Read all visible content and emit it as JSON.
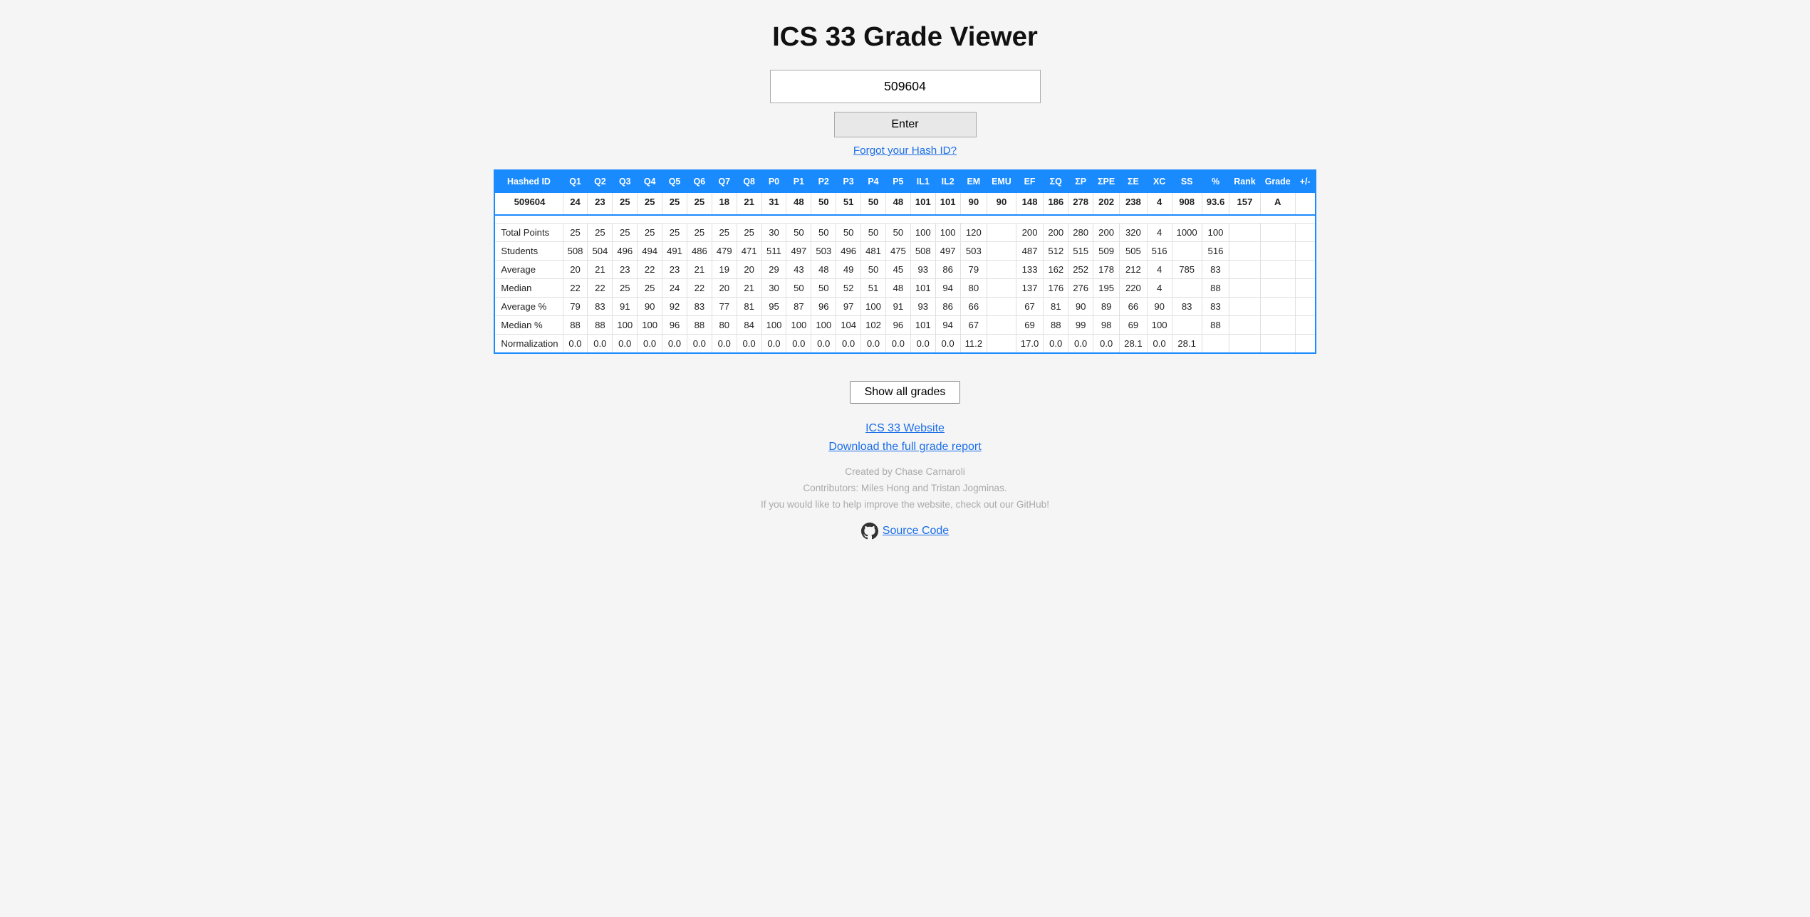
{
  "page": {
    "title": "ICS 33 Grade Viewer",
    "id_input_value": "509604",
    "id_input_placeholder": "",
    "enter_button_label": "Enter",
    "forgot_link_label": "Forgot your Hash ID?"
  },
  "table": {
    "headers": [
      "Hashed ID",
      "Q1",
      "Q2",
      "Q3",
      "Q4",
      "Q5",
      "Q6",
      "Q7",
      "Q8",
      "P0",
      "P1",
      "P2",
      "P3",
      "P4",
      "P5",
      "IL1",
      "IL2",
      "EM",
      "EMU",
      "EF",
      "ΣQ",
      "ΣP",
      "ΣPE",
      "ΣE",
      "XC",
      "SS",
      "%",
      "Rank",
      "Grade",
      "+/-"
    ],
    "student_row": [
      "509604",
      "24",
      "23",
      "25",
      "25",
      "25",
      "25",
      "18",
      "21",
      "31",
      "48",
      "50",
      "51",
      "50",
      "48",
      "101",
      "101",
      "90",
      "90",
      "148",
      "186",
      "278",
      "202",
      "238",
      "4",
      "908",
      "93.6",
      "157",
      "A",
      ""
    ],
    "stats": [
      [
        "Total Points",
        "25",
        "25",
        "25",
        "25",
        "25",
        "25",
        "25",
        "25",
        "30",
        "50",
        "50",
        "50",
        "50",
        "50",
        "100",
        "100",
        "120",
        "",
        "200",
        "200",
        "280",
        "200",
        "320",
        "4",
        "1000",
        "100",
        "",
        "",
        ""
      ],
      [
        "Students",
        "508",
        "504",
        "496",
        "494",
        "491",
        "486",
        "479",
        "471",
        "511",
        "497",
        "503",
        "496",
        "481",
        "475",
        "508",
        "497",
        "503",
        "",
        "487",
        "512",
        "515",
        "509",
        "505",
        "516",
        "",
        "516",
        "",
        "",
        ""
      ],
      [
        "Average",
        "20",
        "21",
        "23",
        "22",
        "23",
        "21",
        "19",
        "20",
        "29",
        "43",
        "48",
        "49",
        "50",
        "45",
        "93",
        "86",
        "79",
        "",
        "133",
        "162",
        "252",
        "178",
        "212",
        "4",
        "785",
        "83",
        "",
        "",
        ""
      ],
      [
        "Median",
        "22",
        "22",
        "25",
        "25",
        "24",
        "22",
        "20",
        "21",
        "30",
        "50",
        "50",
        "52",
        "51",
        "48",
        "101",
        "94",
        "80",
        "",
        "137",
        "176",
        "276",
        "195",
        "220",
        "4",
        "",
        "88",
        "",
        "",
        ""
      ],
      [
        "Average %",
        "79",
        "83",
        "91",
        "90",
        "92",
        "83",
        "77",
        "81",
        "95",
        "87",
        "96",
        "97",
        "100",
        "91",
        "93",
        "86",
        "66",
        "",
        "67",
        "81",
        "90",
        "89",
        "66",
        "90",
        "83",
        "83",
        "",
        "",
        ""
      ],
      [
        "Median %",
        "88",
        "88",
        "100",
        "100",
        "96",
        "88",
        "80",
        "84",
        "100",
        "100",
        "100",
        "104",
        "102",
        "96",
        "101",
        "94",
        "67",
        "",
        "69",
        "88",
        "99",
        "98",
        "69",
        "100",
        "",
        "88",
        "",
        "",
        ""
      ],
      [
        "Normalization",
        "0.0",
        "0.0",
        "0.0",
        "0.0",
        "0.0",
        "0.0",
        "0.0",
        "0.0",
        "0.0",
        "0.0",
        "0.0",
        "0.0",
        "0.0",
        "0.0",
        "0.0",
        "0.0",
        "11.2",
        "",
        "17.0",
        "0.0",
        "0.0",
        "0.0",
        "28.1",
        "0.0",
        "28.1",
        "",
        "",
        "",
        ""
      ]
    ]
  },
  "footer": {
    "show_all_label": "Show all grades",
    "ics_link_label": "ICS 33 Website",
    "download_link_label": "Download the full grade report",
    "created_text": "Created by Chase Carnaroli",
    "contributors_text": "Contributors: Miles Hong and Tristan Jogminas.",
    "help_text": "If you would like to help improve the website, check out our GitHub!",
    "source_code_label": "Source Code"
  }
}
